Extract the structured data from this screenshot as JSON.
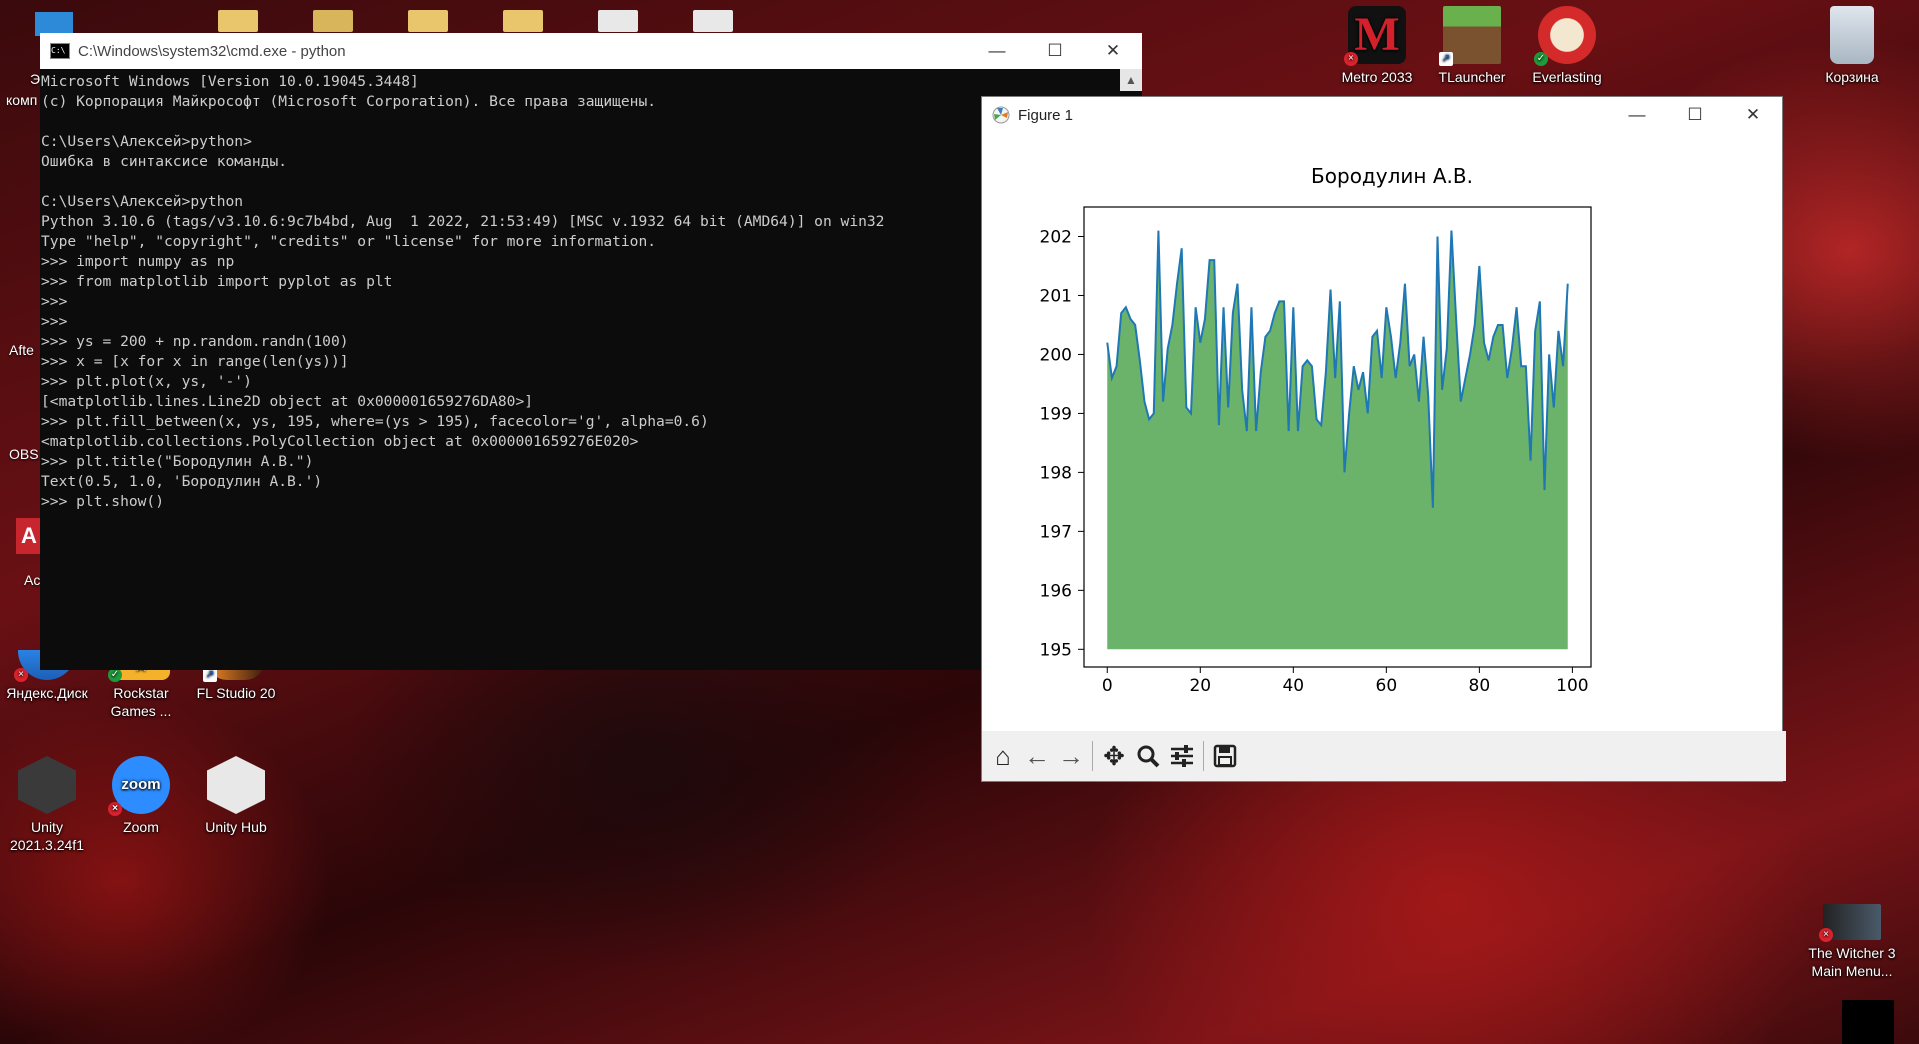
{
  "desktop": {
    "icons": {
      "metro": "Metro 2033",
      "tlauncher": "TLauncher",
      "everlasting": "Everlasting",
      "recycle": "Корзина",
      "yandex": "Яндекс.Диск",
      "rockstar": "Rockstar Games ...",
      "flstudio": "FL Studio 20",
      "unity": "Unity 2021.3.24f1",
      "zoom": "Zoom",
      "unityhub": "Unity Hub",
      "witcher": "The Witcher 3 Main Menu...",
      "left_partial_1": "Э",
      "left_partial_2": "комп",
      "left_partial_3": "Afte",
      "left_partial_4": "OBS",
      "left_partial_5": "Ac",
      "zoom_logo_text": "zoom",
      "metro_logo": "M"
    }
  },
  "cmd": {
    "title": "C:\\Windows\\system32\\cmd.exe - python",
    "lines": [
      "Microsoft Windows [Version 10.0.19045.3448]",
      "(c) Корпорация Майкрософт (Microsoft Corporation). Все права защищены.",
      "",
      "C:\\Users\\Алексей>python>",
      "Ошибка в синтаксисе команды.",
      "",
      "C:\\Users\\Алексей>python",
      "Python 3.10.6 (tags/v3.10.6:9c7b4bd, Aug  1 2022, 21:53:49) [MSC v.1932 64 bit (AMD64)] on win32",
      "Type \"help\", \"copyright\", \"credits\" or \"license\" for more information.",
      ">>> import numpy as np",
      ">>> from matplotlib import pyplot as plt",
      ">>>",
      ">>>",
      ">>> ys = 200 + np.random.randn(100)",
      ">>> x = [x for x in range(len(ys))]",
      ">>> plt.plot(x, ys, '-')",
      "[<matplotlib.lines.Line2D object at 0x000001659276DA80>]",
      ">>> plt.fill_between(x, ys, 195, where=(ys > 195), facecolor='g', alpha=0.6)",
      "<matplotlib.collections.PolyCollection object at 0x000001659276E020>",
      ">>> plt.title(\"Бородулин А.В.\")",
      "Text(0.5, 1.0, 'Бородулин А.В.')",
      ">>> plt.show()"
    ]
  },
  "figure": {
    "title": "Figure 1",
    "toolbar": [
      "home-icon",
      "back-arrow-icon",
      "forward-arrow-icon",
      "pan-icon",
      "zoom-icon",
      "configure-icon",
      "save-icon"
    ]
  },
  "chart_data": {
    "type": "line",
    "title": "Бородулин А.В.",
    "xlabel": "",
    "ylabel": "",
    "xlim": [
      -5,
      104
    ],
    "ylim": [
      194.7,
      202.5
    ],
    "xticks": [
      0,
      20,
      40,
      60,
      80,
      100
    ],
    "yticks": [
      195,
      196,
      197,
      198,
      199,
      200,
      201,
      202
    ],
    "fill_baseline": 195,
    "fill_color": "#6bb36b",
    "line_color": "#1f77b4",
    "grid": false,
    "x": [
      0,
      1,
      2,
      3,
      4,
      5,
      6,
      7,
      8,
      9,
      10,
      11,
      12,
      13,
      14,
      15,
      16,
      17,
      18,
      19,
      20,
      21,
      22,
      23,
      24,
      25,
      26,
      27,
      28,
      29,
      30,
      31,
      32,
      33,
      34,
      35,
      36,
      37,
      38,
      39,
      40,
      41,
      42,
      43,
      44,
      45,
      46,
      47,
      48,
      49,
      50,
      51,
      52,
      53,
      54,
      55,
      56,
      57,
      58,
      59,
      60,
      61,
      62,
      63,
      64,
      65,
      66,
      67,
      68,
      69,
      70,
      71,
      72,
      73,
      74,
      75,
      76,
      77,
      78,
      79,
      80,
      81,
      82,
      83,
      84,
      85,
      86,
      87,
      88,
      89,
      90,
      91,
      92,
      93,
      94,
      95,
      96,
      97,
      98,
      99
    ],
    "y": [
      200.2,
      199.6,
      199.8,
      200.7,
      200.8,
      200.6,
      200.5,
      199.9,
      199.2,
      198.9,
      199.0,
      202.1,
      199.2,
      200.1,
      200.5,
      201.2,
      201.8,
      199.1,
      199.0,
      200.8,
      200.2,
      200.6,
      201.6,
      201.6,
      198.8,
      200.8,
      199.1,
      200.7,
      201.2,
      199.4,
      198.7,
      200.8,
      198.7,
      199.7,
      200.3,
      200.4,
      200.7,
      200.9,
      200.9,
      198.7,
      200.8,
      198.7,
      199.8,
      199.9,
      199.8,
      198.9,
      198.8,
      199.7,
      201.1,
      199.6,
      200.9,
      198.0,
      199.0,
      199.8,
      199.4,
      199.7,
      199.0,
      200.3,
      200.4,
      199.6,
      200.8,
      200.3,
      199.6,
      200.2,
      201.2,
      199.8,
      200.0,
      199.2,
      200.3,
      199.3,
      197.4,
      202.0,
      199.4,
      200.1,
      202.1,
      200.6,
      199.2,
      199.6,
      200.0,
      200.5,
      201.5,
      200.2,
      199.9,
      200.3,
      200.5,
      200.5,
      199.6,
      200.1,
      200.8,
      199.8,
      199.8,
      198.2,
      200.4,
      200.9,
      197.7,
      200.0,
      199.1,
      200.4,
      199.8,
      201.2
    ]
  }
}
